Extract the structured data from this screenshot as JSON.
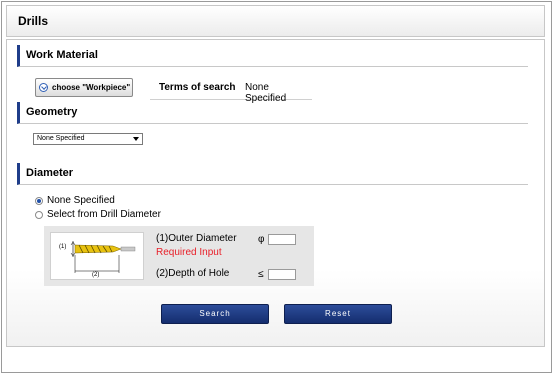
{
  "header": {
    "title": "Drills"
  },
  "work_material": {
    "heading": "Work Material",
    "choose_button": "choose \"Workpiece\"",
    "terms_label": "Terms of search",
    "terms_value": "None Specified"
  },
  "geometry": {
    "heading": "Geometry",
    "select_value": "None Specified"
  },
  "diameter": {
    "heading": "Diameter",
    "options": [
      {
        "label": "None Specified",
        "selected": true
      },
      {
        "label": "Select from Drill Diameter",
        "selected": false
      }
    ],
    "figure": {
      "label_1": "(1)",
      "label_2": "(2)"
    },
    "outer_diameter_label": "(1)Outer Diameter",
    "outer_diameter_symbol": "φ",
    "outer_diameter_value": "",
    "required_text": "Required Input",
    "depth_label": "(2)Depth of Hole",
    "depth_symbol": "≤",
    "depth_value": ""
  },
  "actions": {
    "search": "Search",
    "reset": "Reset"
  },
  "colors": {
    "section_accent": "#1f3d8a",
    "button_bg": "#1a3577",
    "required": "#e8202a"
  }
}
